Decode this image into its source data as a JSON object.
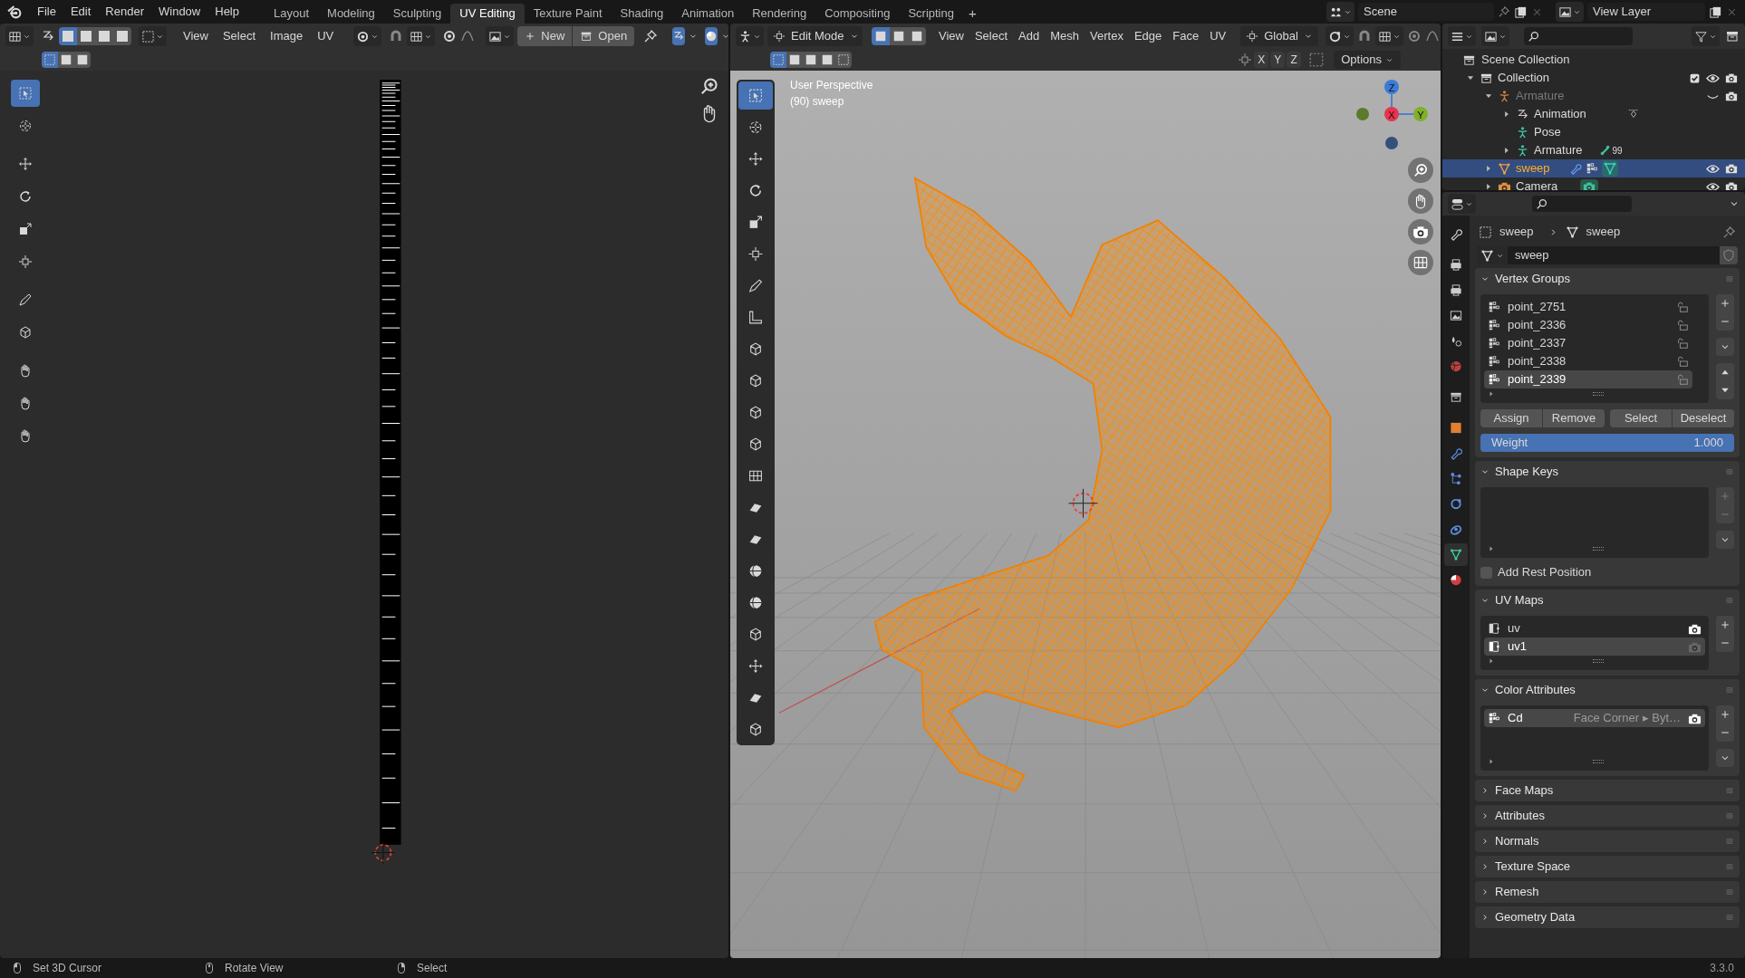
{
  "topbar": {
    "menus": [
      "File",
      "Edit",
      "Render",
      "Window",
      "Help"
    ],
    "workspaces": [
      {
        "label": "Layout",
        "selected": false
      },
      {
        "label": "Modeling",
        "selected": false
      },
      {
        "label": "Sculpting",
        "selected": false
      },
      {
        "label": "UV Editing",
        "selected": true
      },
      {
        "label": "Texture Paint",
        "selected": false
      },
      {
        "label": "Shading",
        "selected": false
      },
      {
        "label": "Animation",
        "selected": false
      },
      {
        "label": "Rendering",
        "selected": false
      },
      {
        "label": "Compositing",
        "selected": false
      },
      {
        "label": "Scripting",
        "selected": false
      }
    ],
    "add_tab": "+",
    "scene": "Scene",
    "view_layer": "View Layer"
  },
  "uv_editor": {
    "menus": [
      "View",
      "Select",
      "Image",
      "UV"
    ],
    "new_button": "New",
    "open_button": "Open"
  },
  "viewport": {
    "mode": "Edit Mode",
    "menus": [
      "View",
      "Select",
      "Add",
      "Mesh",
      "Vertex",
      "Edge",
      "Face",
      "UV"
    ],
    "orientation": "Global",
    "axes": [
      "X",
      "Y",
      "Z"
    ],
    "options": "Options",
    "overlay": [
      "User Perspective",
      "(90) sweep"
    ],
    "gizmo": {
      "z": "Z",
      "x": "X",
      "y": "Y"
    }
  },
  "outliner": {
    "root": "Scene Collection",
    "tree": [
      {
        "label": "Collection",
        "kind": "collection",
        "expanded": true,
        "selected": false,
        "checked": true,
        "hidden": false,
        "children": [
          {
            "label": "Armature",
            "kind": "armature",
            "expanded": true,
            "selected": false,
            "hidden": true,
            "children": [
              {
                "label": "Animation",
                "kind": "animation",
                "expanded": false,
                "selected": false
              },
              {
                "label": "Pose",
                "kind": "pose",
                "selected": false
              },
              {
                "label": "Armature",
                "kind": "armature_data",
                "expanded": false,
                "selected": false,
                "badge": "99"
              }
            ]
          },
          {
            "label": "sweep",
            "kind": "mesh",
            "expanded": false,
            "selected": true,
            "hidden": false
          },
          {
            "label": "Camera",
            "kind": "camera",
            "expanded": false,
            "selected": false,
            "hidden": false
          }
        ]
      }
    ]
  },
  "properties": {
    "breadcrumb": [
      "sweep",
      "sweep"
    ],
    "data_name": "sweep",
    "panels": [
      {
        "kind": "vertex_groups",
        "title": "Vertex Groups",
        "expanded": true,
        "items": [
          {
            "label": "point_2751",
            "selected": false
          },
          {
            "label": "point_2336",
            "selected": false
          },
          {
            "label": "point_2337",
            "selected": false
          },
          {
            "label": "point_2338",
            "selected": false
          },
          {
            "label": "point_2339",
            "selected": true
          }
        ],
        "buttons": [
          "Assign",
          "Remove",
          "Select",
          "Deselect"
        ],
        "weight": {
          "label": "Weight",
          "value": "1.000",
          "level": 1
        }
      },
      {
        "kind": "shape_keys",
        "title": "Shape Keys",
        "expanded": true,
        "checkbox": {
          "label": "Add Rest Position",
          "checked": false
        }
      },
      {
        "kind": "uv_maps",
        "title": "UV Maps",
        "expanded": true,
        "items": [
          {
            "label": "uv",
            "selected": false,
            "render_active": true
          },
          {
            "label": "uv1",
            "selected": true,
            "render_active": false
          }
        ]
      },
      {
        "kind": "color_attributes",
        "title": "Color Attributes",
        "expanded": true,
        "items": [
          {
            "label": "Cd",
            "detail": "Face Corner ▸ Byt…",
            "selected": true,
            "render_active": true
          }
        ]
      },
      {
        "title": "Face Maps",
        "expanded": false
      },
      {
        "title": "Attributes",
        "expanded": false
      },
      {
        "title": "Normals",
        "expanded": false
      },
      {
        "title": "Texture Space",
        "expanded": false
      },
      {
        "title": "Remesh",
        "expanded": false
      },
      {
        "title": "Geometry Data",
        "expanded": false
      }
    ]
  },
  "status_bar": {
    "hints": [
      {
        "label": "Set 3D Cursor",
        "kind": "left"
      },
      {
        "label": "Rotate View",
        "kind": "middle"
      },
      {
        "label": "Select",
        "kind": "right"
      }
    ],
    "version": "3.3.0"
  }
}
